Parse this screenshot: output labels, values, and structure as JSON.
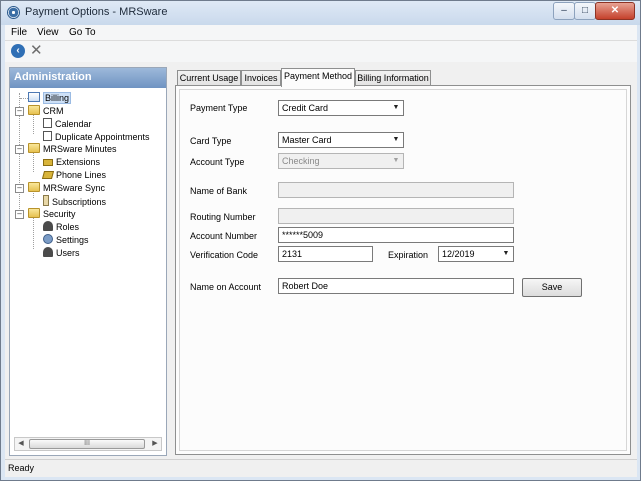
{
  "window": {
    "title": "Payment Options - MRSware",
    "minimize_icon": "minimize-icon",
    "maximize_icon": "maximize-icon",
    "close_icon": "close-icon"
  },
  "menu": [
    "File",
    "View",
    "Go To"
  ],
  "toolbar": {
    "back_icon": "back-arrow-icon",
    "close_icon": "x-icon"
  },
  "sidebar": {
    "header": "Administration",
    "tree": {
      "billing": "Billing",
      "crm": "CRM",
      "calendar": "Calendar",
      "duplicate_appointments": "Duplicate Appointments",
      "minutes": "MRSware Minutes",
      "extensions": "Extensions",
      "phone_lines": "Phone Lines",
      "sync": "MRSware Sync",
      "subscriptions": "Subscriptions",
      "security": "Security",
      "roles": "Roles",
      "settings": "Settings",
      "users": "Users"
    },
    "scroll_thumb": "III"
  },
  "tabs": [
    "Current Usage",
    "Invoices",
    "Payment Method",
    "Billing Information"
  ],
  "active_tab": "Payment Method",
  "form": {
    "payment_type_label": "Payment Type",
    "payment_type_value": "Credit Card",
    "card_type_label": "Card Type",
    "card_type_value": "Master Card",
    "account_type_label": "Account Type",
    "account_type_value": "Checking",
    "bank_label": "Name of Bank",
    "bank_value": "",
    "routing_label": "Routing Number",
    "routing_value": "",
    "account_number_label": "Account Number",
    "account_number_value": "******5009",
    "verification_label": "Verification Code",
    "verification_value": "2131",
    "expiration_label": "Expiration",
    "expiration_value": "12/2019",
    "name_label": "Name on Account",
    "name_value": "Robert Doe",
    "save_label": "Save"
  },
  "status": "Ready"
}
